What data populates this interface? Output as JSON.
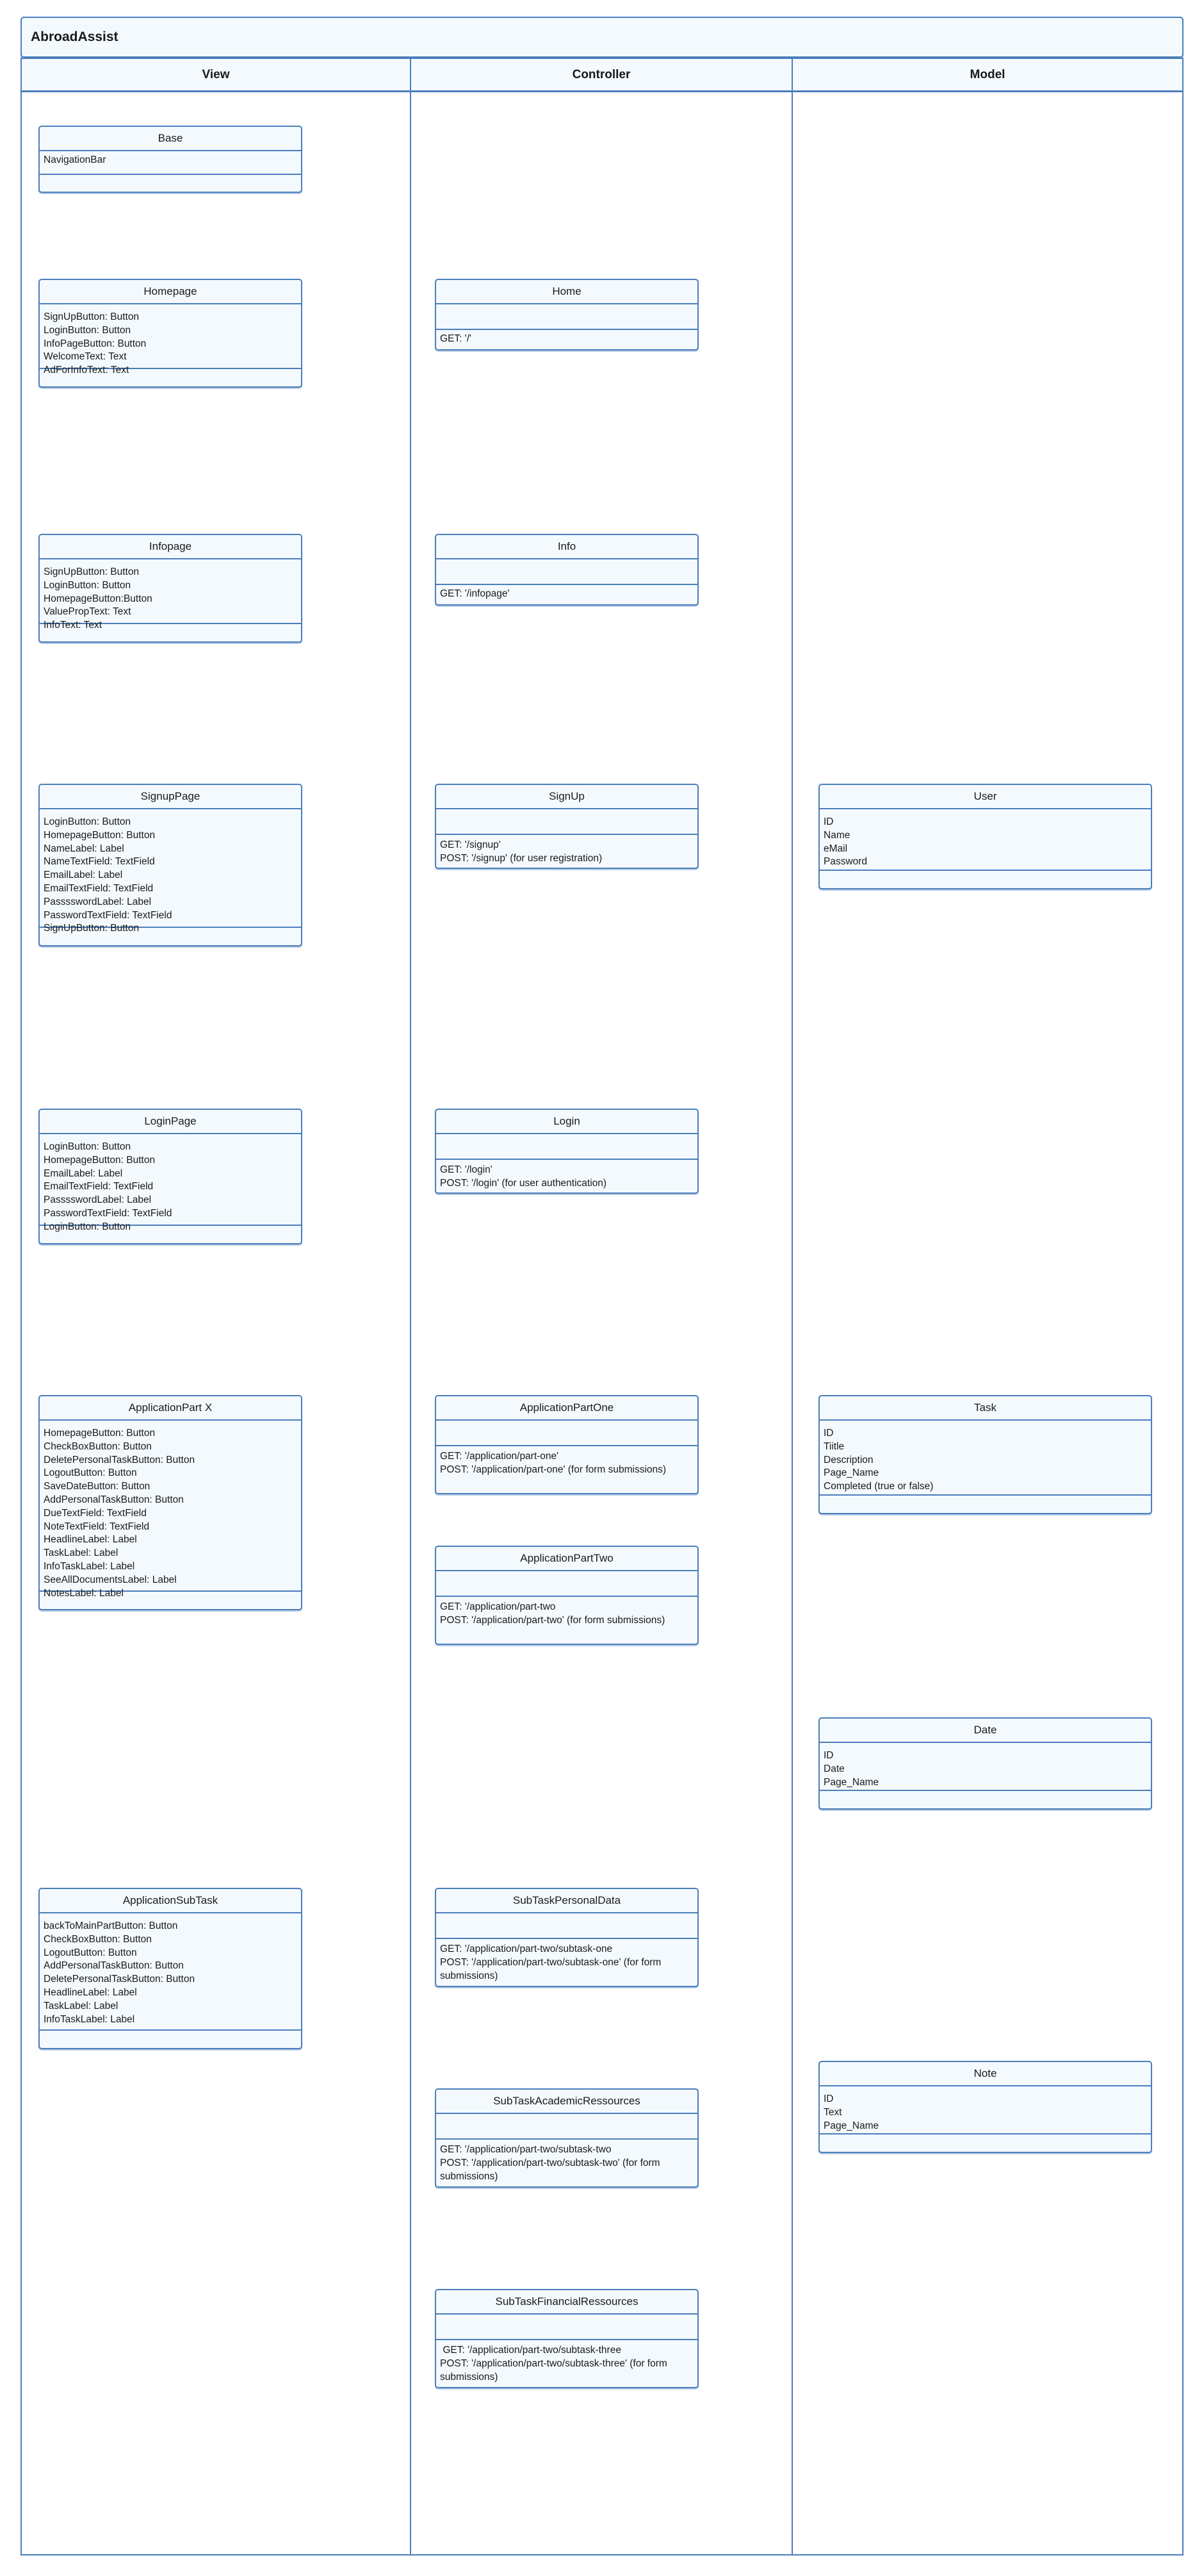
{
  "diagram": {
    "title": "AbroadAssist",
    "colors": {
      "border": "#4a7ebb",
      "fill": "#f4f9fd",
      "background": "#ffffff",
      "text": "#1a1a1a"
    },
    "columns": [
      {
        "id": "view",
        "label": "View"
      },
      {
        "id": "controller",
        "label": "Controller"
      },
      {
        "id": "model",
        "label": "Model"
      }
    ]
  },
  "view": {
    "classes": [
      {
        "name": "Base",
        "attributes": [
          "NavigationBar"
        ],
        "operations": []
      },
      {
        "name": "Homepage",
        "attributes": [
          "SignUpButton: Button",
          "LoginButton: Button",
          "InfoPageButton: Button",
          "WelcomeText: Text",
          "AdForInfoText: Text"
        ],
        "operations": []
      },
      {
        "name": "Infopage",
        "attributes": [
          "SignUpButton: Button",
          "LoginButton: Button",
          "HomepageButton:Button",
          "ValuePropText: Text",
          "InfoText: Text"
        ],
        "operations": []
      },
      {
        "name": "SignupPage",
        "attributes": [
          "LoginButton: Button",
          "HomepageButton: Button",
          "NameLabel: Label",
          "NameTextField: TextField",
          "EmailLabel: Label",
          "EmailTextField: TextField",
          "PasssswordLabel: Label",
          "PasswordTextField: TextField",
          "SignUpButton: Button"
        ],
        "operations": []
      },
      {
        "name": "LoginPage",
        "attributes": [
          "LoginButton: Button",
          "HomepageButton: Button",
          "EmailLabel: Label",
          "EmailTextField: TextField",
          "PasssswordLabel: Label",
          "PasswordTextField: TextField",
          "LoginButton: Button"
        ],
        "operations": []
      },
      {
        "name": "ApplicationPart X",
        "attributes": [
          "HomepageButton: Button",
          "CheckBoxButton: Button",
          "DeletePersonalTaskButton: Button",
          "LogoutButton: Button",
          "SaveDateButton: Button",
          "AddPersonalTaskButton: Button",
          "DueTextField: TextField",
          "NoteTextField: TextField",
          "HeadlineLabel: Label",
          "TaskLabel: Label",
          "InfoTaskLabel: Label",
          "SeeAllDocumentsLabel: Label",
          "NotesLabel: Label"
        ],
        "operations": []
      },
      {
        "name": "ApplicationSubTask",
        "attributes": [
          "backToMainPartButton: Button",
          "CheckBoxButton: Button",
          "LogoutButton: Button",
          "AddPersonalTaskButton: Button",
          "DeletePersonalTaskButton: Button",
          "HeadlineLabel: Label",
          "TaskLabel: Label",
          "InfoTaskLabel: Label"
        ],
        "operations": []
      }
    ]
  },
  "controller": {
    "classes": [
      {
        "name": "Home",
        "attributes": [],
        "operations": [
          "GET: '/'"
        ]
      },
      {
        "name": "Info",
        "attributes": [],
        "operations": [
          "GET: '/infopage'"
        ]
      },
      {
        "name": "SignUp",
        "attributes": [],
        "operations": [
          "GET: '/signup'",
          "POST: '/signup' (for user registration)"
        ]
      },
      {
        "name": "Login",
        "attributes": [],
        "operations": [
          "GET: '/login'",
          "POST: '/login' (for user authentication)"
        ]
      },
      {
        "name": "ApplicationPartOne",
        "attributes": [],
        "operations": [
          "GET: '/application/part-one'",
          "POST: '/application/part-one' (for form submissions)"
        ]
      },
      {
        "name": "ApplicationPartTwo",
        "attributes": [],
        "operations": [
          "GET: '/application/part-two",
          "POST: '/application/part-two' (for form submissions)"
        ]
      },
      {
        "name": "SubTaskPersonalData",
        "attributes": [],
        "operations": [
          "GET: '/application/part-two/subtask-one",
          "POST: '/application/part-two/subtask-one' (for form submissions)"
        ]
      },
      {
        "name": "SubTaskAcademicRessources",
        "attributes": [],
        "operations": [
          "GET: '/application/part-two/subtask-two",
          "POST: '/application/part-two/subtask-two' (for form submissions)"
        ]
      },
      {
        "name": "SubTaskFinancialRessources",
        "attributes": [],
        "operations": [
          " GET: '/application/part-two/subtask-three",
          "POST: '/application/part-two/subtask-three' (for form submissions)"
        ]
      }
    ]
  },
  "model": {
    "classes": [
      {
        "name": "User",
        "attributes": [
          "ID",
          "Name",
          "eMail",
          "Password"
        ],
        "operations": []
      },
      {
        "name": "Task",
        "attributes": [
          "ID",
          "Tiitle",
          "Description",
          "Page_Name",
          "Completed (true or false)"
        ],
        "operations": []
      },
      {
        "name": "Date",
        "attributes": [
          "ID",
          "Date",
          "Page_Name"
        ],
        "operations": []
      },
      {
        "name": "Note",
        "attributes": [
          "ID",
          "Text",
          "Page_Name"
        ],
        "operations": []
      }
    ]
  }
}
